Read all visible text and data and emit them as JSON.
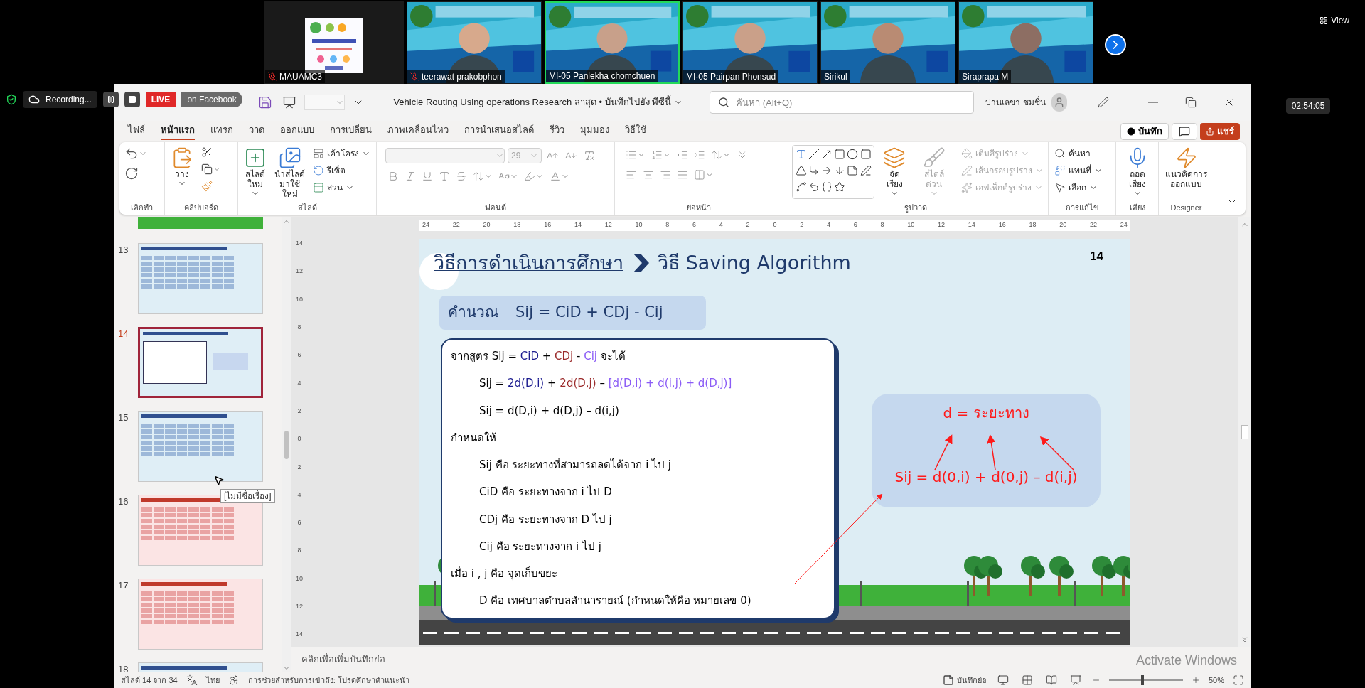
{
  "meeting": {
    "tiles": [
      {
        "name": "MAUAMC3",
        "kind": "poster",
        "muted": true,
        "speaking": false
      },
      {
        "name": "teerawat prakobphon",
        "kind": "camera",
        "muted": true,
        "speaking": false
      },
      {
        "name": "MI-05 Panlekha chomchuen",
        "kind": "camera",
        "muted": false,
        "speaking": true
      },
      {
        "name": "MI-05 Pairpan Phonsud",
        "kind": "camera",
        "muted": false,
        "speaking": false
      },
      {
        "name": "Sirikul",
        "kind": "camera",
        "muted": false,
        "speaking": false
      },
      {
        "name": "Siraprapa M",
        "kind": "camera",
        "muted": false,
        "speaking": false
      }
    ],
    "view_button": "View",
    "clock": "02:54:05",
    "recording": {
      "label": "Recording...",
      "live": "LIVE",
      "destination": "on Facebook"
    }
  },
  "window": {
    "title": "Vehicle Routing Using operations Research ล่าสุด • บันทึกไปยัง พีซีนี้",
    "search_placeholder": "ค้นหา (Alt+Q)",
    "user": "ปานเลขา ชมชื่น"
  },
  "tabs": [
    {
      "label": "ไฟล์",
      "selected": false
    },
    {
      "label": "หน้าแรก",
      "selected": true
    },
    {
      "label": "แทรก",
      "selected": false
    },
    {
      "label": "วาด",
      "selected": false
    },
    {
      "label": "ออกแบบ",
      "selected": false
    },
    {
      "label": "การเปลี่ยน",
      "selected": false
    },
    {
      "label": "ภาพเคลื่อนไหว",
      "selected": false
    },
    {
      "label": "การนำเสนอสไลด์",
      "selected": false
    },
    {
      "label": "รีวิว",
      "selected": false
    },
    {
      "label": "มุมมอง",
      "selected": false
    },
    {
      "label": "วิธีใช้",
      "selected": false
    }
  ],
  "record_button": "บันทึก",
  "share_button": "แชร์",
  "ribbon": {
    "groups": [
      {
        "label": "เลิกทำ"
      },
      {
        "label": "คลิปบอร์ด",
        "items": [
          {
            "label": "วาง",
            "disabled": false
          }
        ]
      },
      {
        "label": "สไลด์",
        "items": [
          {
            "label": "สไลด์ใหม่",
            "disabled": false
          },
          {
            "label": "นำสไลด์มาใช้ใหม่",
            "disabled": false
          },
          {
            "label": "เค้าโครง",
            "disabled": false
          },
          {
            "label": "รีเซ็ต",
            "disabled": false
          },
          {
            "label": "ส่วน",
            "disabled": false
          }
        ]
      },
      {
        "label": "ฟอนต์",
        "items": [
          {
            "label": "29",
            "disabled": true
          }
        ]
      },
      {
        "label": "ย่อหน้า"
      },
      {
        "label": "รูปวาด",
        "items": [
          {
            "label": "จัดเรียง",
            "disabled": false
          },
          {
            "label": "สไตล์ด่วน",
            "disabled": true
          },
          {
            "label": "เติมสีรูปร่าง",
            "disabled": true
          },
          {
            "label": "เส้นกรอบรูปร่าง",
            "disabled": true
          },
          {
            "label": "เอฟเฟ็กต์รูปร่าง",
            "disabled": true
          }
        ]
      },
      {
        "label": "การแก้ไข",
        "items": [
          {
            "label": "ค้นหา",
            "disabled": false
          },
          {
            "label": "แทนที่",
            "disabled": false
          },
          {
            "label": "เลือก",
            "disabled": false
          }
        ]
      },
      {
        "label": "เสียง",
        "items": [
          {
            "label": "ถอดเสียง",
            "disabled": false
          }
        ]
      },
      {
        "label": "Designer",
        "items": [
          {
            "label": "แนวคิดการออกแบบ",
            "disabled": false
          }
        ]
      }
    ]
  },
  "thumbnails": [
    {
      "number": "13",
      "selected": false,
      "kind": "table"
    },
    {
      "number": "14",
      "selected": true,
      "kind": "text"
    },
    {
      "number": "15",
      "selected": false,
      "kind": "table"
    },
    {
      "number": "16",
      "selected": false,
      "kind": "redtable"
    },
    {
      "number": "17",
      "selected": false,
      "kind": "redtable"
    },
    {
      "number": "18",
      "selected": false,
      "kind": "text"
    }
  ],
  "thumbnail_tooltip": "[ไม่มีชื่อเรื่อง]",
  "rulers": {
    "horizontal": [
      "24",
      "22",
      "20",
      "18",
      "16",
      "14",
      "12",
      "10",
      "8",
      "6",
      "4",
      "2",
      "0",
      "2",
      "4",
      "6",
      "8",
      "10",
      "12",
      "14",
      "16",
      "18",
      "20",
      "22",
      "24"
    ],
    "vertical": [
      "14",
      "12",
      "10",
      "8",
      "6",
      "4",
      "2",
      "0",
      "2",
      "4",
      "6",
      "8",
      "10",
      "12",
      "14"
    ]
  },
  "slide": {
    "title": "วิธีการดำเนินการศึกษา",
    "subtitle": "วิธี Saving Algorithm",
    "number": "14",
    "formula_label": "คำนวณ",
    "formula": "Sij = CiD + CDj - Cij",
    "lines": [
      {
        "indented": false,
        "segments": [
          {
            "text": "จากสูตร Sij = ",
            "color": "#000000"
          },
          {
            "text": "CiD",
            "color": "#1c1c8f"
          },
          {
            "text": " + ",
            "color": "#000000"
          },
          {
            "text": "CDj",
            "color": "#9b2b2b"
          },
          {
            "text": " - ",
            "color": "#000000"
          },
          {
            "text": "Cij",
            "color": "#8b5cf6"
          },
          {
            "text": " จะได้",
            "color": "#000000"
          }
        ]
      },
      {
        "indented": true,
        "segments": [
          {
            "text": "Sij = ",
            "color": "#000000"
          },
          {
            "text": "2d(D,i)",
            "color": "#1c1c8f"
          },
          {
            "text": " + ",
            "color": "#000000"
          },
          {
            "text": "2d(D,j)",
            "color": "#9b2b2b"
          },
          {
            "text": " – ",
            "color": "#000000"
          },
          {
            "text": "[d(D,i) + d(i,j) + d(D,j)]",
            "color": "#8b5cf6"
          }
        ]
      },
      {
        "indented": true,
        "segments": [
          {
            "text": "Sij = d(D,i) + d(D,j) – d(i,j)",
            "color": "#000000"
          }
        ]
      },
      {
        "indented": false,
        "segments": [
          {
            "text": "กำหนดให้",
            "color": "#000000"
          }
        ]
      },
      {
        "indented": true,
        "segments": [
          {
            "text": "Sij คือ ระยะทางที่สามารถลดได้จาก i ไป j",
            "color": "#000000"
          }
        ]
      },
      {
        "indented": true,
        "segments": [
          {
            "text": "CiD คือ ระยะทางจาก i ไป D",
            "color": "#000000"
          }
        ]
      },
      {
        "indented": true,
        "segments": [
          {
            "text": "CDj คือ ระยะทางจาก D ไป j",
            "color": "#000000"
          }
        ]
      },
      {
        "indented": true,
        "segments": [
          {
            "text": "Cij คือ ระยะทางจาก i ไป j",
            "color": "#000000"
          }
        ]
      },
      {
        "indented": false,
        "segments": [
          {
            "text": "เมื่อ i , j คือ จุดเก็บขยะ",
            "color": "#000000"
          }
        ]
      },
      {
        "indented": true,
        "segments": [
          {
            "text": "D คือ เทศบาลตำบลลำนารายณ์ (กำหนดให้คือ หมายเลข 0)",
            "color": "#000000"
          }
        ]
      }
    ],
    "callout_title": "d = ระยะทาง",
    "callout_formula": "Sij = d(0,i) + d(0,j) – d(i,j)"
  },
  "notes_placeholder": "คลิกเพื่อเพิ่มบันทึกย่อ",
  "status_bar": {
    "slide_count": "สไลด์ 14 จาก 34",
    "language": "ไทย",
    "accessibility": "การช่วยสำหรับการเข้าถึง: โปรดศึกษาคำแนะนำ",
    "notes_button": "บันทึกย่อ",
    "zoom": "50%",
    "zoom_slider": {
      "level": 0.45
    }
  },
  "os_notice": "Activate Windows"
}
